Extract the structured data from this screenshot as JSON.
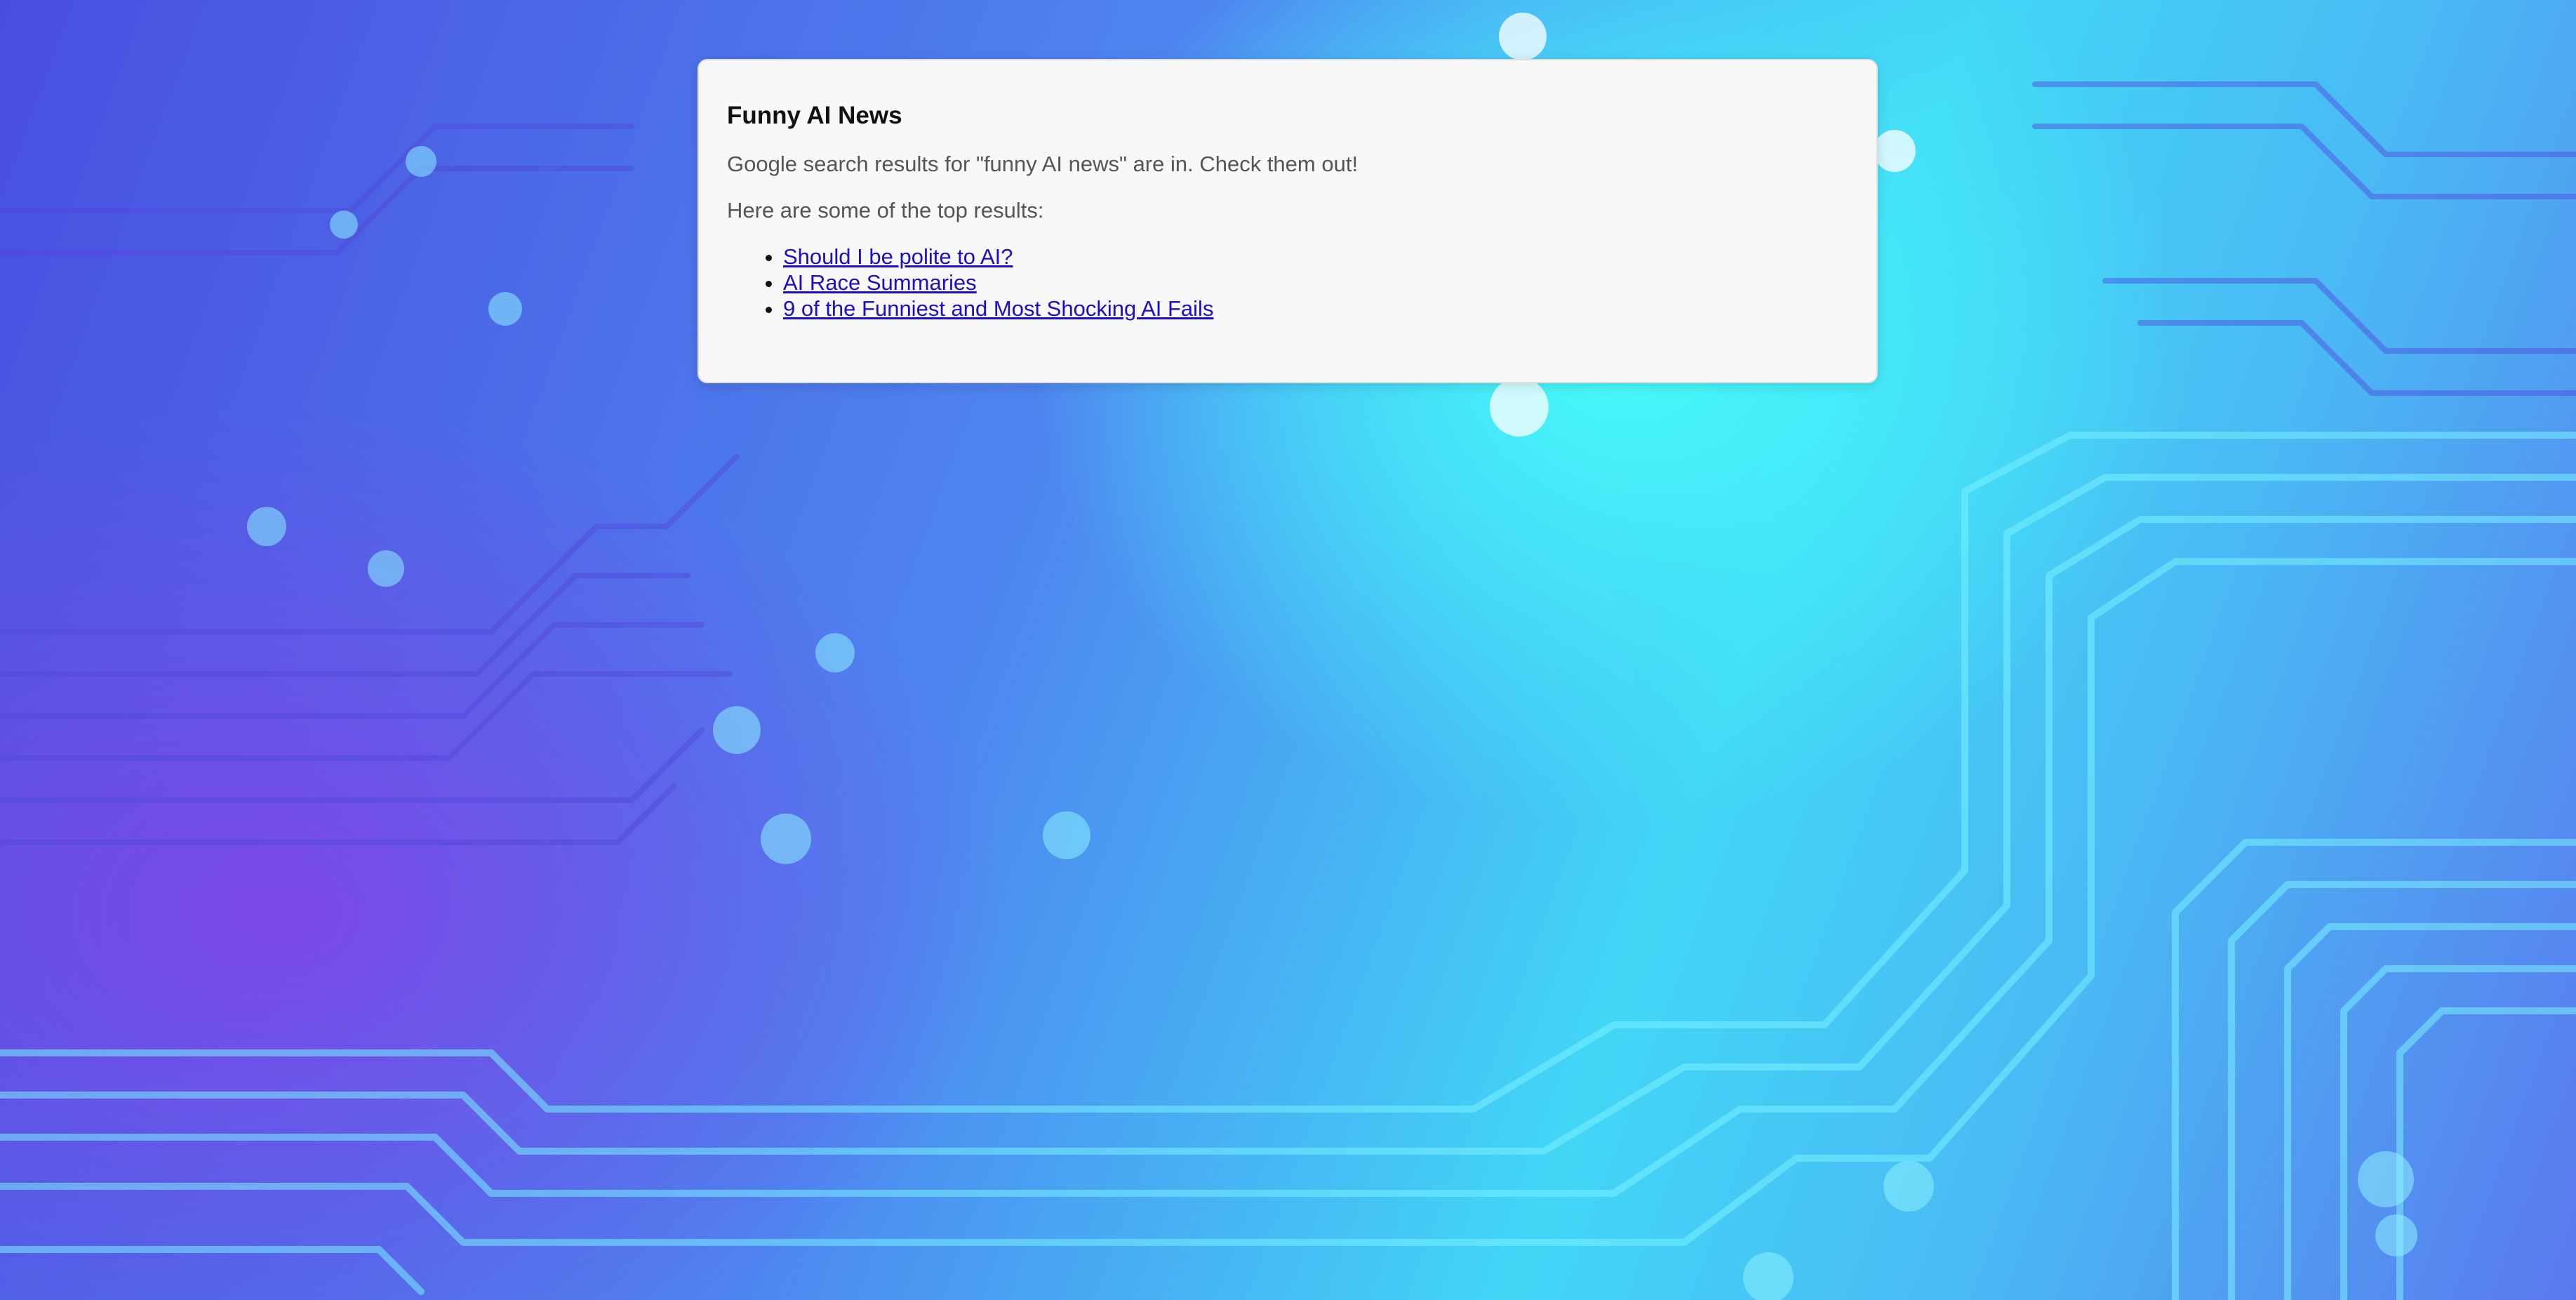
{
  "page": {
    "title": "Funny AI News",
    "intro": "Google search results for \"funny AI news\" are in. Check them out!",
    "results_heading": "Here are some of the top results:",
    "results": [
      {
        "label": "Should I be polite to AI?"
      },
      {
        "label": "AI Race Summaries"
      },
      {
        "label": "9 of the Funniest and Most Shocking AI Fails"
      }
    ]
  },
  "colors": {
    "link": "#1a0dcc",
    "card_background": "#f8f8f8",
    "background_primary": "#4a7cf0",
    "background_highlight": "#46fffa",
    "background_purple": "#8c3ce6"
  },
  "icons": [
    "circuit-board-background"
  ]
}
